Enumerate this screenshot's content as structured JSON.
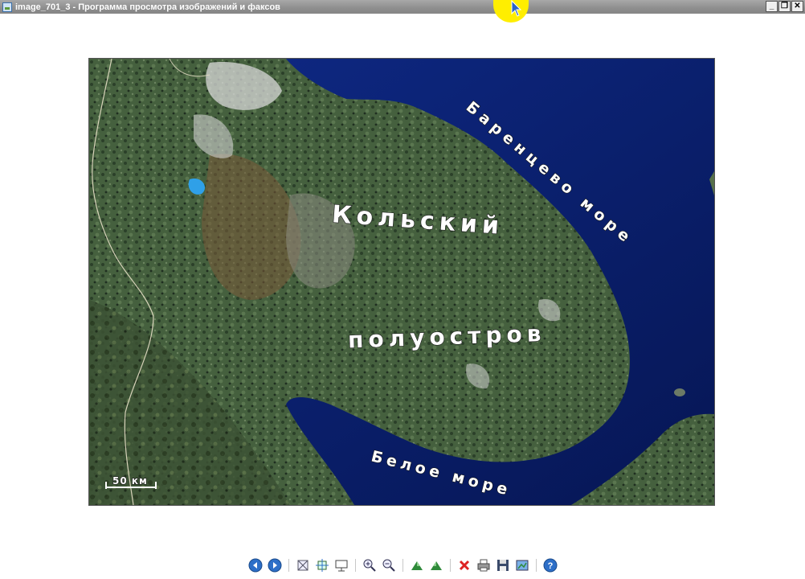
{
  "window": {
    "title": "image_701_3 - Программа просмотра изображений и факсов",
    "controls": {
      "minimize": "_",
      "restore": "❐",
      "close": "✕"
    }
  },
  "image": {
    "labels": {
      "peninsula_line1": "Кольский",
      "peninsula_line2": "полуостров",
      "barents_sea": "Баренцево море",
      "white_sea": "Белое море",
      "scale": "50 км"
    },
    "colors": {
      "sea": "#0b1f6e",
      "land_dark": "#2f4a32",
      "land_mid": "#4d6a44",
      "land_brown": "#7a5a38",
      "snow": "#d8d8d8"
    }
  },
  "toolbar": {
    "buttons": [
      {
        "name": "previous-image-button",
        "icon": "arrow-left-icon"
      },
      {
        "name": "next-image-button",
        "icon": "arrow-right-icon"
      },
      {
        "name": "best-fit-button",
        "icon": "best-fit-icon"
      },
      {
        "name": "actual-size-button",
        "icon": "actual-size-icon"
      },
      {
        "name": "slideshow-button",
        "icon": "slideshow-icon"
      },
      {
        "name": "zoom-in-button",
        "icon": "zoom-in-icon"
      },
      {
        "name": "zoom-out-button",
        "icon": "zoom-out-icon"
      },
      {
        "name": "rotate-clockwise-button",
        "icon": "rotate-cw-icon"
      },
      {
        "name": "rotate-counterclockwise-button",
        "icon": "rotate-ccw-icon"
      },
      {
        "name": "delete-button",
        "icon": "delete-icon"
      },
      {
        "name": "print-button",
        "icon": "print-icon"
      },
      {
        "name": "save-button",
        "icon": "save-icon"
      },
      {
        "name": "edit-button",
        "icon": "edit-icon"
      },
      {
        "name": "help-button",
        "icon": "help-icon"
      }
    ]
  }
}
